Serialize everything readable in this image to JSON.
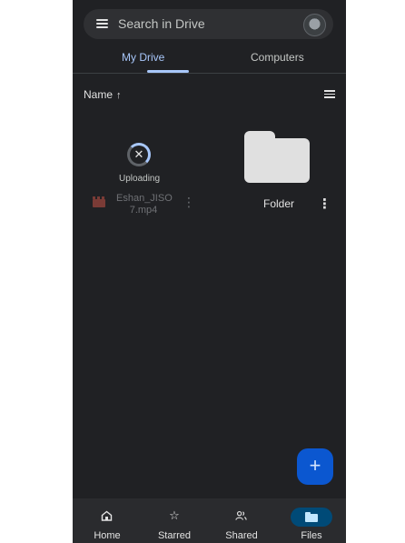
{
  "search": {
    "placeholder": "Search in Drive"
  },
  "tabs": [
    {
      "label": "My Drive",
      "active": true
    },
    {
      "label": "Computers",
      "active": false
    }
  ],
  "sort": {
    "label": "Name",
    "direction": "↑"
  },
  "items": [
    {
      "type": "video",
      "name": "Eshan_JIS07.mp4",
      "name_display": "Eshan_JISO\n7.mp4",
      "status": "Uploading"
    },
    {
      "type": "folder",
      "name": "Folder"
    }
  ],
  "icons": {
    "more": "⋮",
    "cancel": "✕",
    "star": "☆",
    "plus": "+"
  },
  "fab": {
    "label": "+"
  },
  "nav": [
    {
      "label": "Home",
      "icon": "home-icon"
    },
    {
      "label": "Starred",
      "icon": "star-icon"
    },
    {
      "label": "Shared",
      "icon": "shared-icon"
    },
    {
      "label": "Files",
      "icon": "folder-icon",
      "active": true
    }
  ],
  "colors": {
    "accent": "#a8c7fa",
    "background": "#202124",
    "fab": "#0b57d0",
    "folder": "#e0e0e0"
  }
}
